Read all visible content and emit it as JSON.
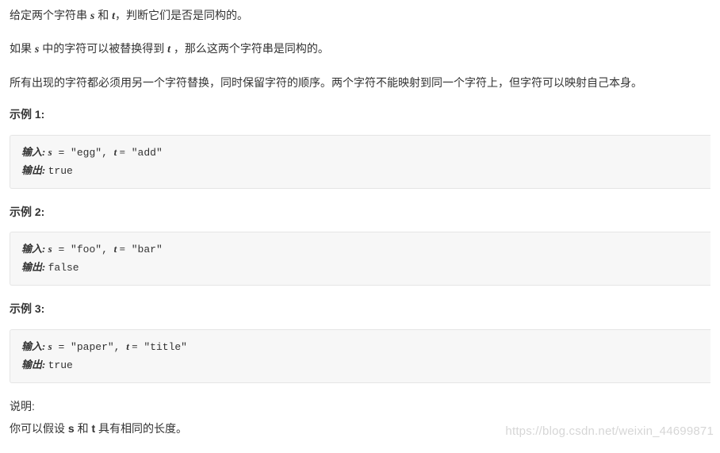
{
  "paragraphs": {
    "p1_pre": "给定两个字符串 ",
    "p1_s": "s",
    "p1_mid1": " 和 ",
    "p1_t": "t",
    "p1_post": "，判断它们是否是同构的。",
    "p2_pre": "如果 ",
    "p2_s": "s",
    "p2_mid": " 中的字符可以被替换得到 ",
    "p2_t": "t",
    "p2_post": " ，那么这两个字符串是同构的。",
    "p3": "所有出现的字符都必须用另一个字符替换，同时保留字符的顺序。两个字符不能映射到同一个字符上，但字符可以映射自己本身。"
  },
  "examples": [
    {
      "heading": "示例 1:",
      "input_label": "输入: ",
      "s_var": "s",
      "s_eq": " = \"egg\", ",
      "t_var": "t =",
      "t_val": " \"add\"",
      "output_label": "输出: ",
      "output_val": "true"
    },
    {
      "heading": "示例 2:",
      "input_label": "输入: ",
      "s_var": "s",
      "s_eq": " = \"foo\", ",
      "t_var": "t =",
      "t_val": " \"bar\"",
      "output_label": "输出: ",
      "output_val": "false"
    },
    {
      "heading": "示例 3:",
      "input_label": "输入: ",
      "s_var": "s",
      "s_eq": " = \"paper\", ",
      "t_var": "t =",
      "t_val": " \"title\"",
      "output_label": "输出: ",
      "output_val": "true"
    }
  ],
  "notes": {
    "heading": "说明:",
    "body_pre": "你可以假设 ",
    "body_s": "s",
    "body_mid": " 和 ",
    "body_t": "t",
    "body_post": " 具有相同的长度。"
  },
  "watermark": "https://blog.csdn.net/weixin_44699871"
}
